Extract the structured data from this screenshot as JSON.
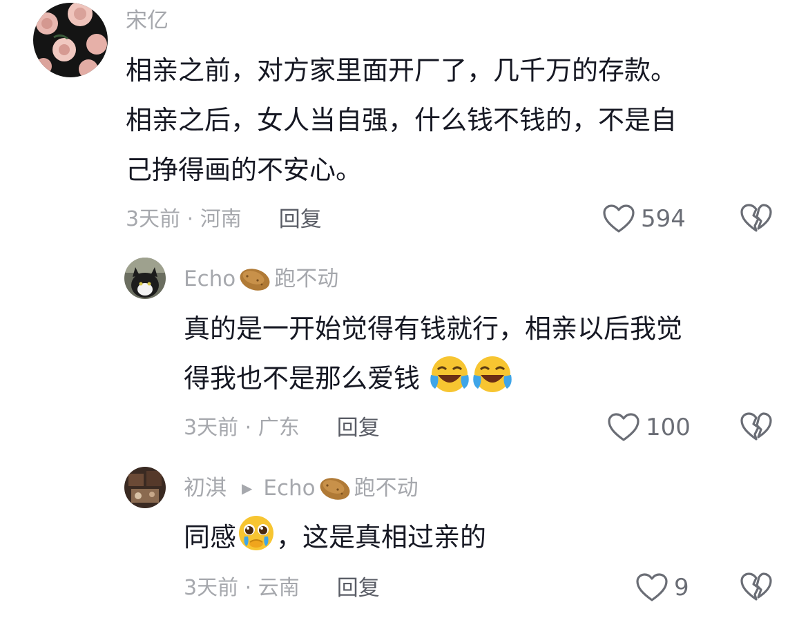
{
  "comments": [
    {
      "username": "宋亿",
      "content": [
        "相亲之前，对方家里面开厂了，几千万的存款。",
        "相亲之后，女人当自强，什么钱不钱的，不是自",
        "己挣得画的不安心。"
      ],
      "time_location": "3天前 · 河南",
      "reply_label": "回复",
      "likes": "594"
    },
    {
      "username": "Echo",
      "username_suffix": "跑不动",
      "content": [
        "真的是一开始觉得有钱就行，相亲以后我觉",
        "得我也不是那么爱钱"
      ],
      "time_location": "3天前 · 广东",
      "reply_label": "回复",
      "likes": "100"
    },
    {
      "username": "初淇",
      "reply_to": "Echo",
      "reply_to_suffix": "跑不动",
      "content": [
        "同感",
        "，这是真相过亲的"
      ],
      "time_location": "3天前 · 云南",
      "reply_label": "回复",
      "likes": "9"
    }
  ],
  "icons": {
    "like": "heart-outline-icon",
    "dislike": "broken-heart-icon",
    "potato_emoji": "potato-emoji",
    "laugh_cry_emoji": "laughing-crying-emoji",
    "pleading_emoji": "pleading-face-emoji"
  }
}
